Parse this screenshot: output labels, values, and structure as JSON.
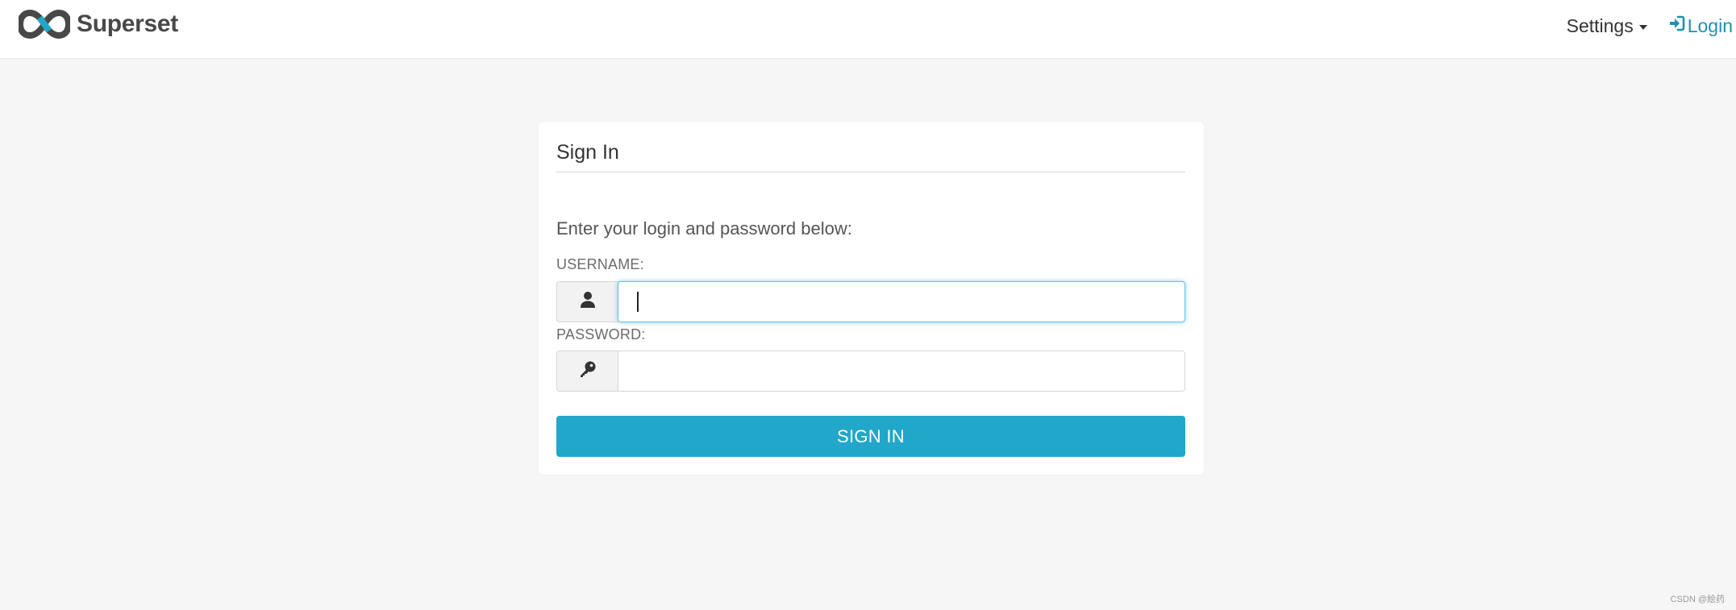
{
  "navbar": {
    "brand": {
      "name": "Superset",
      "icon": "superset-infinity-logo",
      "logo_colors": [
        "#484848",
        "#20a7c9"
      ]
    },
    "settings": {
      "label": "Settings",
      "icon": "caret-down-icon"
    },
    "login": {
      "label": "Login",
      "icon": "sign-in-icon",
      "color": "#1f8fb0"
    }
  },
  "signin_card": {
    "title": "Sign In",
    "instructions": "Enter your login and password below:",
    "username": {
      "label": "USERNAME:",
      "icon": "user-icon",
      "value": "",
      "focused": true
    },
    "password": {
      "label": "PASSWORD:",
      "icon": "key-icon",
      "value": ""
    },
    "submit": {
      "label": "SIGN IN",
      "color": "#20a7c9"
    }
  },
  "watermark": "CSDN @絵药"
}
